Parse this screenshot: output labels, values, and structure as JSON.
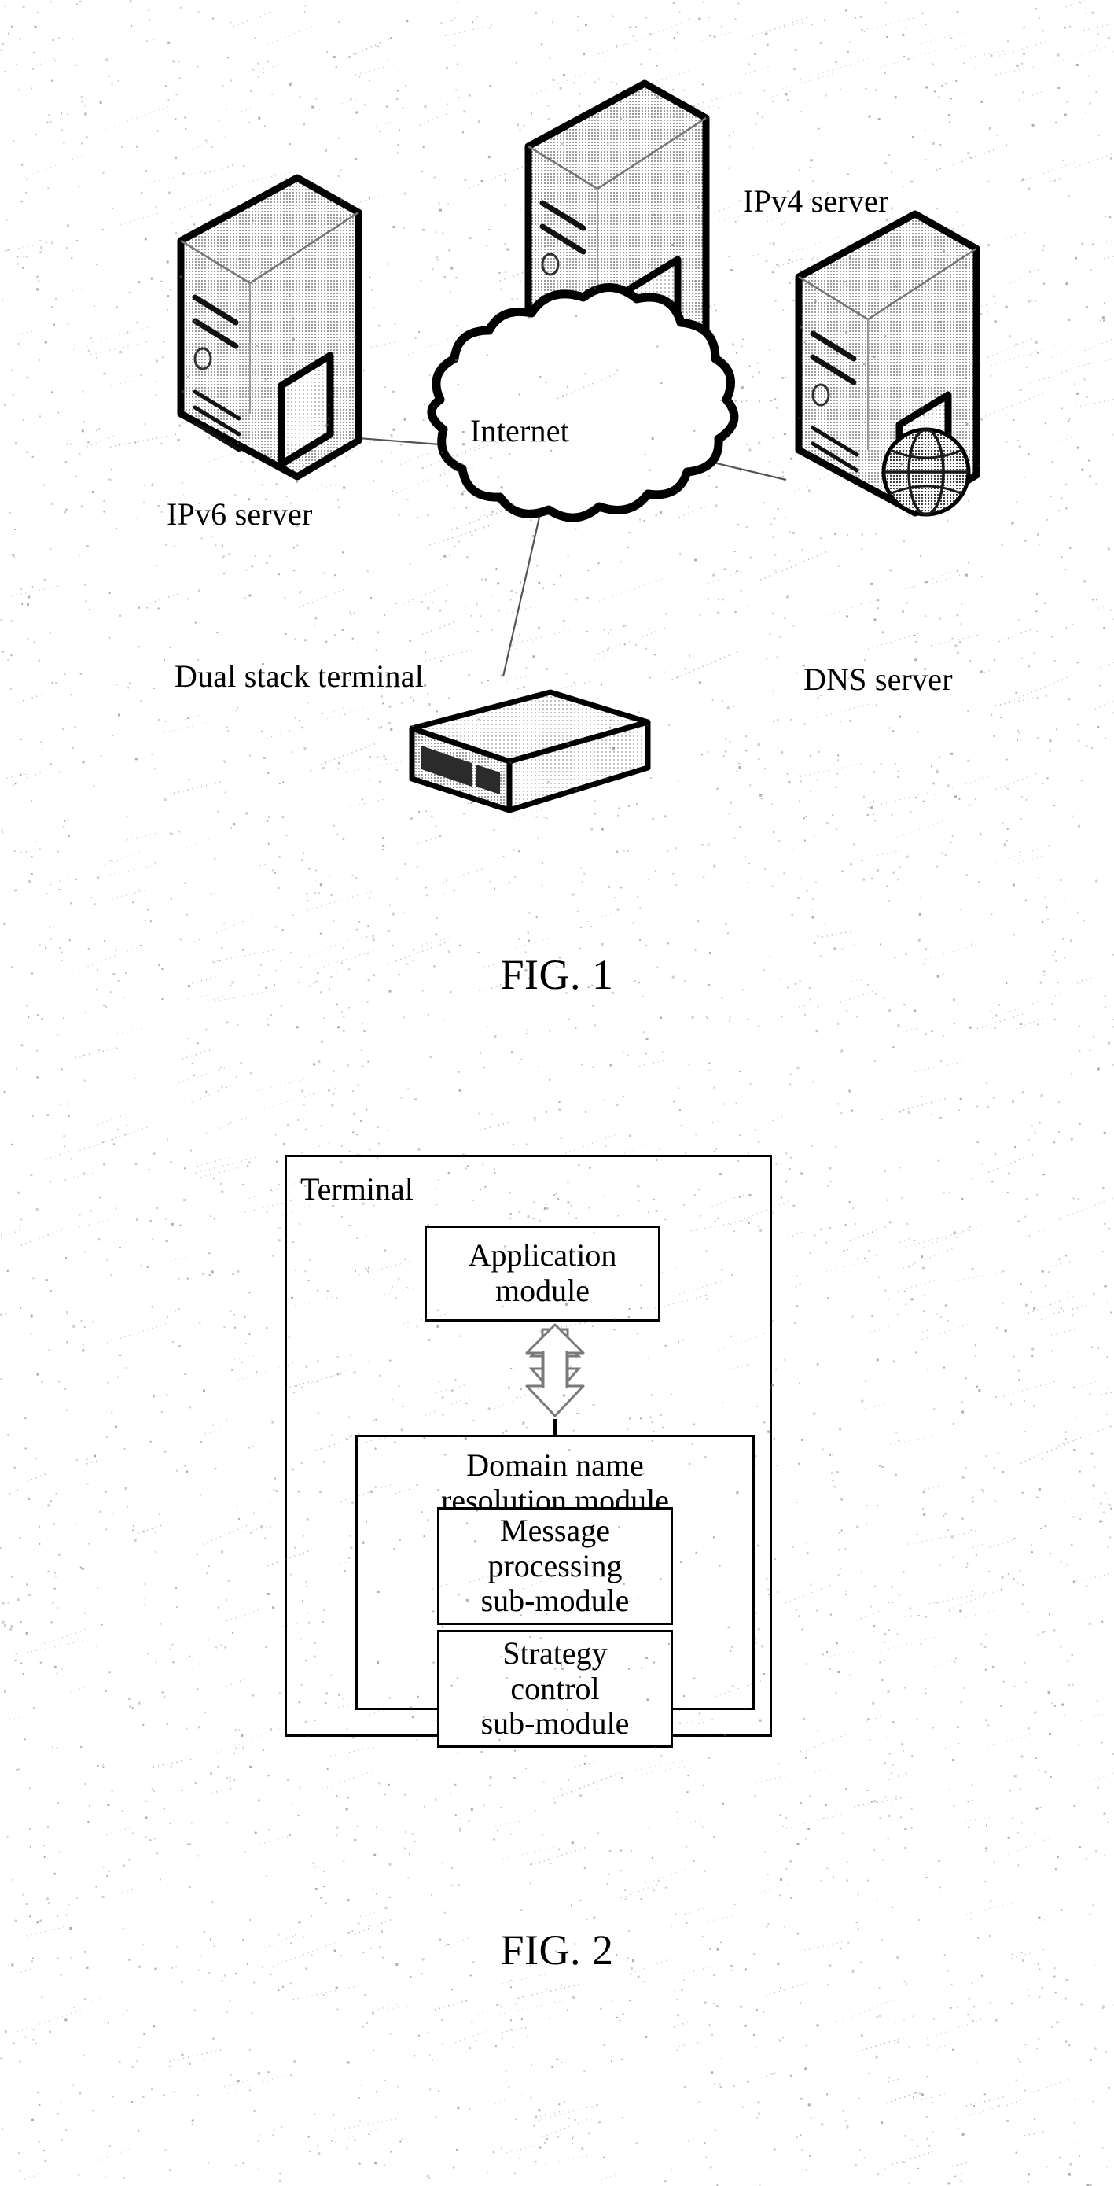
{
  "document": {
    "type": "patent-drawing-sheet",
    "sheet_background": "#ffffff",
    "ink_color": "#000000"
  },
  "figure1": {
    "caption": "FIG. 1",
    "nodes": [
      {
        "id": "ipv6_server",
        "label": "IPv6 server",
        "icon": "server-tower-icon"
      },
      {
        "id": "ipv4_server",
        "label": "IPv4 server",
        "icon": "server-tower-icon"
      },
      {
        "id": "dns_server",
        "label": "DNS server",
        "icon": "server-tower-globe-icon"
      },
      {
        "id": "internet_cloud",
        "label": "Internet",
        "icon": "cloud-icon"
      },
      {
        "id": "dual_stack_terminal",
        "label": "Dual stack terminal",
        "icon": "set-top-box-icon"
      }
    ],
    "links": [
      {
        "from": "ipv6_server",
        "to": "internet_cloud"
      },
      {
        "from": "ipv4_server",
        "to": "internet_cloud"
      },
      {
        "from": "dns_server",
        "to": "internet_cloud"
      },
      {
        "from": "dual_stack_terminal",
        "to": "internet_cloud"
      }
    ]
  },
  "figure2": {
    "caption": "FIG. 2",
    "terminal_label": "Terminal",
    "application_module": "Application\nmodule",
    "application_module_line1": "Application",
    "application_module_line2": "module",
    "domain_name_resolution_module_line1": "Domain name",
    "domain_name_resolution_module_line2": "resolution module",
    "message_processing_submodule_line1": "Message",
    "message_processing_submodule_line2": "processing",
    "message_processing_submodule_line3": "sub-module",
    "strategy_control_submodule_line1": "Strategy",
    "strategy_control_submodule_line2": "control",
    "strategy_control_submodule_line3": "sub-module",
    "arrow": "double-headed-vertical-arrow"
  }
}
